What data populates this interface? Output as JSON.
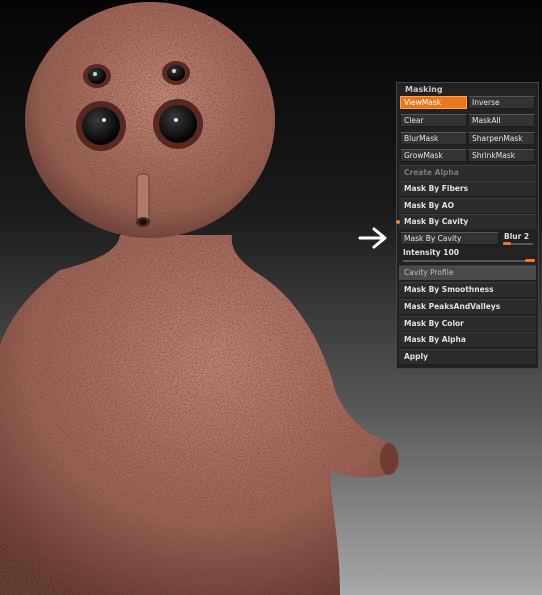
{
  "masking": {
    "title": "Masking",
    "view_mask": "ViewMask",
    "inverse": "Inverse",
    "clear": "Clear",
    "mask_all": "MaskAll",
    "blur_mask": "BlurMask",
    "sharpen_mask": "SharpenMask",
    "grow_mask": "GrowMask",
    "shrink_mask": "ShrinkMask",
    "create_alpha": "Create Alpha",
    "mask_by_fibers": "Mask By Fibers",
    "mask_by_ao": "Mask By AO",
    "mask_by_cavity_header": "Mask By Cavity",
    "mask_by_cavity_button": "Mask By Cavity",
    "blur_label": "Blur 2",
    "blur_value": 0.25,
    "intensity_label": "Intensity 100",
    "intensity_value": 1.0,
    "cavity_profile": "Cavity Profile",
    "mask_by_smoothness": "Mask By Smoothness",
    "mask_peaks_and_valleys": "Mask PeaksAndValleys",
    "mask_by_color": "Mask By Color",
    "mask_by_alpha": "Mask By Alpha",
    "apply": "Apply"
  },
  "colors": {
    "accent": "#e8781e",
    "skin": "#a9685c",
    "panel_bg": "#222222"
  },
  "icons": {
    "pointer": "right-arrow-icon"
  }
}
